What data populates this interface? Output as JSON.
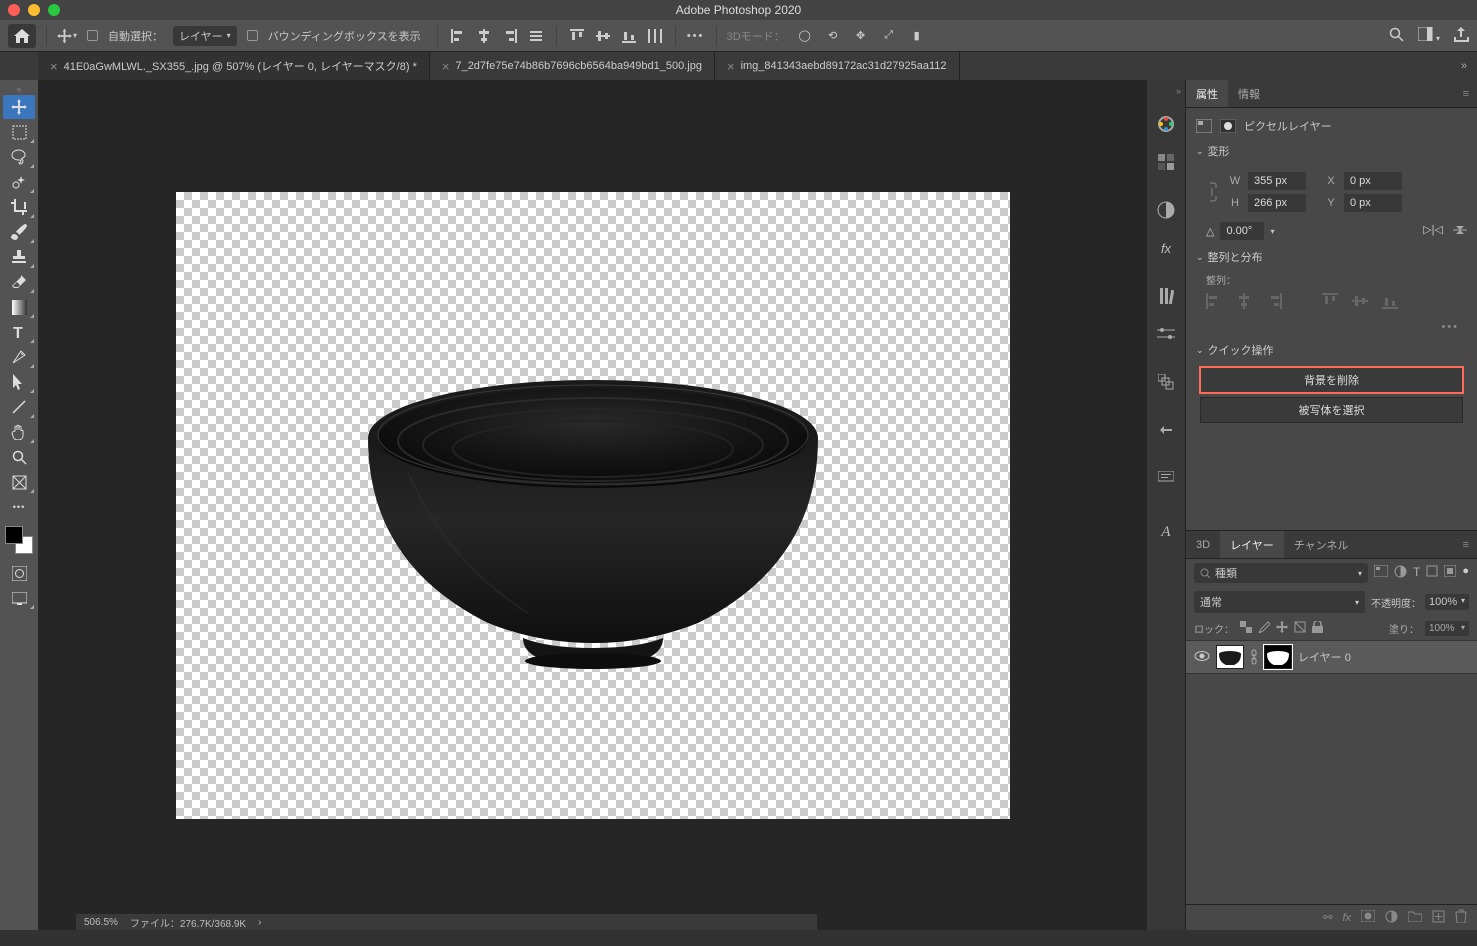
{
  "app": {
    "title": "Adobe Photoshop 2020"
  },
  "options": {
    "auto_select_label": "自動選択：",
    "target_dropdown": "レイヤー",
    "bbox_label": "バウンディングボックスを表示",
    "mode3d_label": "3Dモード："
  },
  "tabs": [
    "41E0aGwMLWL._SX355_.jpg @ 507% (レイヤー 0, レイヤーマスク/8) *",
    "7_2d7fe75e74b86b7696cb6564ba949bd1_500.jpg",
    "img_841343aebd89172ac31d27925aa112"
  ],
  "properties": {
    "tab_properties": "属性",
    "tab_info": "情報",
    "type_label": "ピクセルレイヤー",
    "transform_label": "変形",
    "w_label": "W",
    "w_value": "355 px",
    "h_label": "H",
    "h_value": "266 px",
    "x_label": "X",
    "x_value": "0 px",
    "y_label": "Y",
    "y_value": "0 px",
    "angle_value": "0.00°",
    "align_header": "整列と分布",
    "align_label": "整列：",
    "quick_header": "クイック操作",
    "remove_bg": "背景を削除",
    "select_subject": "被写体を選択"
  },
  "layers_panel": {
    "tab_3d": "3D",
    "tab_layers": "レイヤー",
    "tab_channels": "チャンネル",
    "filter_type": "種類",
    "blend_mode": "通常",
    "opacity_label": "不透明度：",
    "opacity_value": "100%",
    "lock_label": "ロック：",
    "fill_label": "塗り：",
    "fill_value": "100%",
    "layer_name": "レイヤー 0"
  },
  "status": {
    "zoom": "506.5%",
    "file_info": "ファイル：276.7K/368.9K"
  }
}
